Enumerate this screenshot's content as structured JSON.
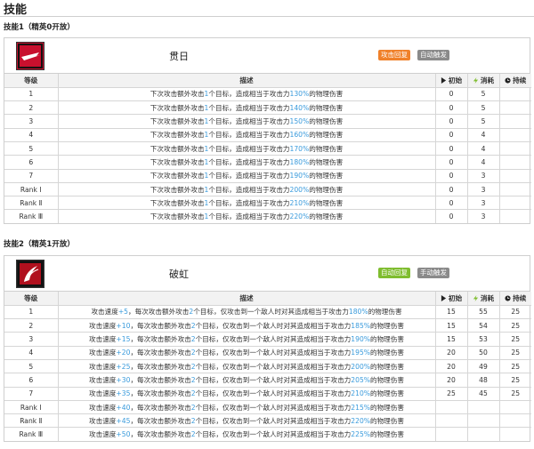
{
  "page_title": "技能",
  "skills": [
    {
      "section_label": "技能1（精英0开放）",
      "name": "贯日",
      "tags": [
        {
          "label": "攻击回复",
          "style": "orange"
        },
        {
          "label": "自动触发",
          "style": "gray"
        }
      ],
      "headers": {
        "level": "等级",
        "desc": "描述",
        "initial": "初始",
        "cost": "消耗",
        "duration": "持续"
      },
      "rows": [
        {
          "level": "1",
          "d1": "下次攻击额外攻击",
          "n1": "1",
          "d2": "个目标，造成相当于攻击力",
          "n2": "130%",
          "d3": "的物理伤害",
          "initial": "0",
          "cost": "5",
          "duration": ""
        },
        {
          "level": "2",
          "d1": "下次攻击额外攻击",
          "n1": "1",
          "d2": "个目标，造成相当于攻击力",
          "n2": "140%",
          "d3": "的物理伤害",
          "initial": "0",
          "cost": "5",
          "duration": ""
        },
        {
          "level": "3",
          "d1": "下次攻击额外攻击",
          "n1": "1",
          "d2": "个目标，造成相当于攻击力",
          "n2": "150%",
          "d3": "的物理伤害",
          "initial": "0",
          "cost": "5",
          "duration": ""
        },
        {
          "level": "4",
          "d1": "下次攻击额外攻击",
          "n1": "1",
          "d2": "个目标，造成相当于攻击力",
          "n2": "160%",
          "d3": "的物理伤害",
          "initial": "0",
          "cost": "4",
          "duration": ""
        },
        {
          "level": "5",
          "d1": "下次攻击额外攻击",
          "n1": "1",
          "d2": "个目标，造成相当于攻击力",
          "n2": "170%",
          "d3": "的物理伤害",
          "initial": "0",
          "cost": "4",
          "duration": ""
        },
        {
          "level": "6",
          "d1": "下次攻击额外攻击",
          "n1": "1",
          "d2": "个目标，造成相当于攻击力",
          "n2": "180%",
          "d3": "的物理伤害",
          "initial": "0",
          "cost": "4",
          "duration": ""
        },
        {
          "level": "7",
          "d1": "下次攻击额外攻击",
          "n1": "1",
          "d2": "个目标，造成相当于攻击力",
          "n2": "190%",
          "d3": "的物理伤害",
          "initial": "0",
          "cost": "3",
          "duration": ""
        },
        {
          "level": "Rank Ⅰ",
          "d1": "下次攻击额外攻击",
          "n1": "1",
          "d2": "个目标，造成相当于攻击力",
          "n2": "200%",
          "d3": "的物理伤害",
          "initial": "0",
          "cost": "3",
          "duration": ""
        },
        {
          "level": "Rank Ⅱ",
          "d1": "下次攻击额外攻击",
          "n1": "1",
          "d2": "个目标，造成相当于攻击力",
          "n2": "210%",
          "d3": "的物理伤害",
          "initial": "0",
          "cost": "3",
          "duration": ""
        },
        {
          "level": "Rank Ⅲ",
          "d1": "下次攻击额外攻击",
          "n1": "1",
          "d2": "个目标，造成相当于攻击力",
          "n2": "220%",
          "d3": "的物理伤害",
          "initial": "0",
          "cost": "3",
          "duration": ""
        }
      ]
    },
    {
      "section_label": "技能2（精英1开放）",
      "name": "破虹",
      "tags": [
        {
          "label": "自动回复",
          "style": "green"
        },
        {
          "label": "手动触发",
          "style": "gray"
        }
      ],
      "headers": {
        "level": "等级",
        "desc": "描述",
        "initial": "初始",
        "cost": "消耗",
        "duration": "持续"
      },
      "rows": [
        {
          "level": "1",
          "d1": "攻击速度",
          "n1": "+5",
          "d2": "，每次攻击额外攻击",
          "n2": "2",
          "d3": "个目标，仅攻击到一个敌人时对其造成相当于攻击力",
          "n3": "180%",
          "d4": "的物理伤害",
          "initial": "15",
          "cost": "55",
          "duration": "25"
        },
        {
          "level": "2",
          "d1": "攻击速度",
          "n1": "+10",
          "d2": "，每次攻击额外攻击",
          "n2": "2",
          "d3": "个目标，仅攻击到一个敌人时对其造成相当于攻击力",
          "n3": "185%",
          "d4": "的物理伤害",
          "initial": "15",
          "cost": "54",
          "duration": "25"
        },
        {
          "level": "3",
          "d1": "攻击速度",
          "n1": "+15",
          "d2": "，每次攻击额外攻击",
          "n2": "2",
          "d3": "个目标，仅攻击到一个敌人时对其造成相当于攻击力",
          "n3": "190%",
          "d4": "的物理伤害",
          "initial": "15",
          "cost": "53",
          "duration": "25"
        },
        {
          "level": "4",
          "d1": "攻击速度",
          "n1": "+20",
          "d2": "，每次攻击额外攻击",
          "n2": "2",
          "d3": "个目标，仅攻击到一个敌人时对其造成相当于攻击力",
          "n3": "195%",
          "d4": "的物理伤害",
          "initial": "20",
          "cost": "50",
          "duration": "25"
        },
        {
          "level": "5",
          "d1": "攻击速度",
          "n1": "+25",
          "d2": "，每次攻击额外攻击",
          "n2": "2",
          "d3": "个目标，仅攻击到一个敌人时对其造成相当于攻击力",
          "n3": "200%",
          "d4": "的物理伤害",
          "initial": "20",
          "cost": "49",
          "duration": "25"
        },
        {
          "level": "6",
          "d1": "攻击速度",
          "n1": "+30",
          "d2": "，每次攻击额外攻击",
          "n2": "2",
          "d3": "个目标，仅攻击到一个敌人时对其造成相当于攻击力",
          "n3": "205%",
          "d4": "的物理伤害",
          "initial": "20",
          "cost": "48",
          "duration": "25"
        },
        {
          "level": "7",
          "d1": "攻击速度",
          "n1": "+35",
          "d2": "，每次攻击额外攻击",
          "n2": "2",
          "d3": "个目标，仅攻击到一个敌人时对其造成相当于攻击力",
          "n3": "210%",
          "d4": "的物理伤害",
          "initial": "25",
          "cost": "45",
          "duration": "25"
        },
        {
          "level": "Rank Ⅰ",
          "d1": "攻击速度",
          "n1": "+40",
          "d2": "，每次攻击额外攻击",
          "n2": "2",
          "d3": "个目标，仅攻击到一个敌人时对其造成相当于攻击力",
          "n3": "215%",
          "d4": "的物理伤害",
          "initial": "",
          "cost": "",
          "duration": ""
        },
        {
          "level": "Rank Ⅱ",
          "d1": "攻击速度",
          "n1": "+45",
          "d2": "，每次攻击额外攻击",
          "n2": "2",
          "d3": "个目标，仅攻击到一个敌人时对其造成相当于攻击力",
          "n3": "220%",
          "d4": "的物理伤害",
          "initial": "",
          "cost": "",
          "duration": ""
        },
        {
          "level": "Rank Ⅲ",
          "d1": "攻击速度",
          "n1": "+50",
          "d2": "，每次攻击额外攻击",
          "n2": "2",
          "d3": "个目标，仅攻击到一个敌人时对其造成相当于攻击力",
          "n3": "225%",
          "d4": "的物理伤害",
          "initial": "",
          "cost": "",
          "duration": ""
        }
      ]
    }
  ],
  "colors": {
    "highlight": "#3a9bdc",
    "tag_orange": "#f0812a",
    "tag_green": "#7fbd2f",
    "tag_gray": "#8a8a8a"
  },
  "icons": {
    "initial": "play-icon",
    "cost": "lightning-icon",
    "duration": "clock-icon"
  }
}
